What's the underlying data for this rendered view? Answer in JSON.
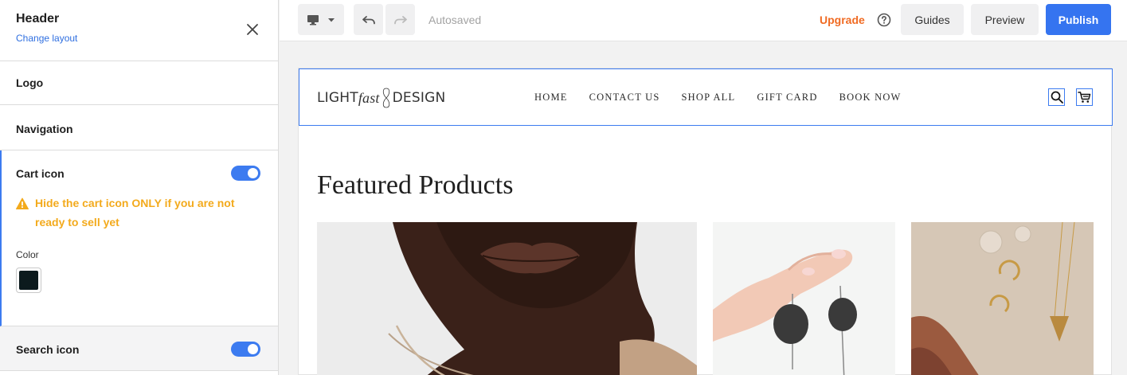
{
  "panel": {
    "title": "Header",
    "change_layout": "Change layout",
    "sections": {
      "logo": "Logo",
      "navigation": "Navigation",
      "cart": {
        "label": "Cart icon",
        "enabled": true,
        "warning": "Hide the cart icon ONLY if you are not ready to sell yet",
        "color_label": "Color",
        "color_value": "#0c1a1d"
      },
      "search": {
        "label": "Search icon",
        "enabled": true
      }
    }
  },
  "toolbar": {
    "autosaved": "Autosaved",
    "upgrade": "Upgrade",
    "guides": "Guides",
    "preview": "Preview",
    "publish": "Publish"
  },
  "site": {
    "logo": {
      "part1": "LIGHT",
      "part2": "fast",
      "part3": "DESIGN"
    },
    "nav": [
      "HOME",
      "CONTACT US",
      "SHOP ALL",
      "GIFT CARD",
      "BOOK NOW"
    ],
    "featured_title": "Featured Products"
  },
  "colors": {
    "accent": "#3c7bf0",
    "publish": "#3574f0",
    "upgrade": "#f06b23",
    "warning": "#f3aa1c"
  }
}
